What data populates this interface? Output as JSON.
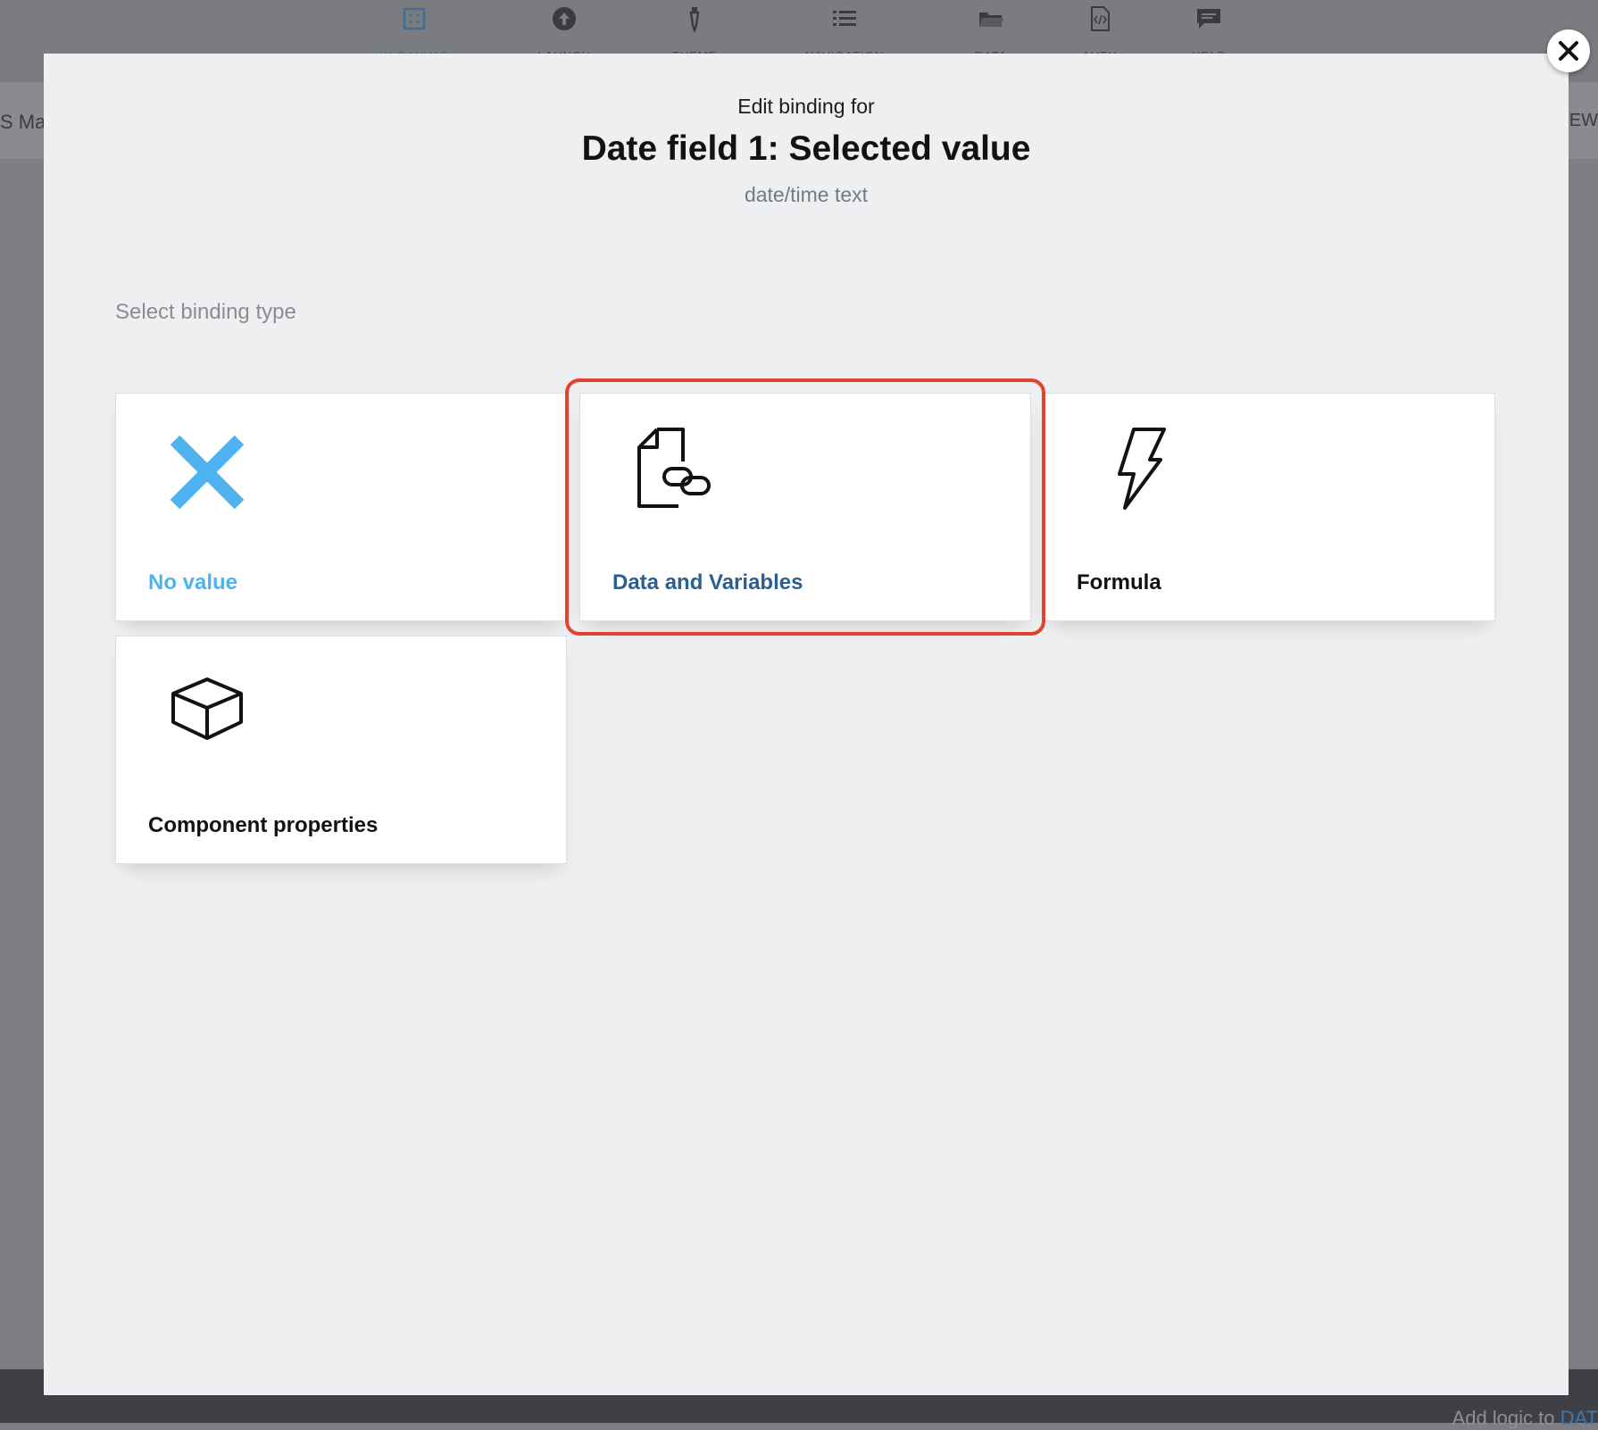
{
  "topbar": {
    "items": [
      {
        "label": "UI CANVAS",
        "icon": "canvas-icon",
        "active": true
      },
      {
        "label": "LAUNCH",
        "icon": "launch-icon",
        "active": false
      },
      {
        "label": "THEME",
        "icon": "theme-icon",
        "active": false
      },
      {
        "label": "NAVIGATION",
        "icon": "navigation-icon",
        "active": false
      },
      {
        "label": "DATA",
        "icon": "folder-icon",
        "active": false
      },
      {
        "label": "AUTH",
        "icon": "auth-icon",
        "active": false
      },
      {
        "label": "HELP",
        "icon": "chat-icon",
        "active": false
      }
    ]
  },
  "subbar": {
    "left_text": "S Ma",
    "right_text": "EW"
  },
  "bottom": {
    "hint_prefix": "Add logic to",
    "hint_link": "DAT"
  },
  "modal": {
    "kicker": "Edit binding for",
    "title": "Date field 1: Selected value",
    "subtitle": "date/time text",
    "section_label": "Select binding type",
    "close_icon": "close-icon",
    "options": [
      {
        "label": "No value",
        "icon": "x-icon",
        "color": "#4fb3f0"
      },
      {
        "label": "Data and Variables",
        "icon": "document-link-icon",
        "color": "#2b5f8f",
        "highlighted": true
      },
      {
        "label": "Formula",
        "icon": "lightning-icon",
        "color": "#111214"
      },
      {
        "label": "Component properties",
        "icon": "cube-icon",
        "color": "#111214"
      }
    ],
    "highlight_color": "#e2432f"
  }
}
